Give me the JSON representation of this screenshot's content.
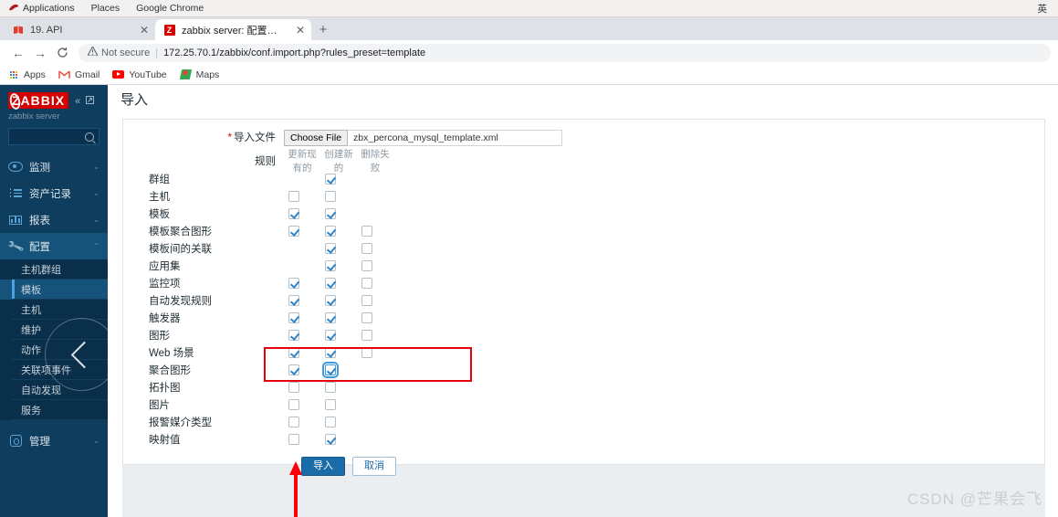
{
  "os_bar": {
    "apps_label": "Applications",
    "places_label": "Places",
    "app_label": "Google Chrome",
    "input_method": "英"
  },
  "browser": {
    "tabs": [
      {
        "title": "19. API",
        "favicon": "book-icon",
        "active": false
      },
      {
        "title": "zabbix server: 配置导入",
        "favicon": "zabbix-icon",
        "active": true
      }
    ],
    "new_tab_label": "+",
    "close_label": "✕",
    "back_label": "←",
    "forward_label": "→",
    "reload_label": "C",
    "security_label": "Not secure",
    "security_icon": "warning-triangle-icon",
    "url": "172.25.70.1/zabbix/conf.import.php?rules_preset=template",
    "bookmarks": [
      {
        "label": "Apps",
        "icon": "apps-grid-icon"
      },
      {
        "label": "Gmail",
        "icon": "gmail-icon"
      },
      {
        "label": "YouTube",
        "icon": "youtube-icon"
      },
      {
        "label": "Maps",
        "icon": "maps-icon"
      }
    ]
  },
  "sidebar": {
    "brand": "ZABBIX",
    "collapse_label": "«",
    "hide_label": "⇱",
    "server_name": "zabbix server",
    "search_placeholder": "",
    "nav": [
      {
        "label": "监测",
        "icon": "eye-icon",
        "caret": "⌄",
        "active": false
      },
      {
        "label": "资产记录",
        "icon": "list-icon",
        "caret": "⌄",
        "active": false
      },
      {
        "label": "报表",
        "icon": "bar-chart-icon",
        "caret": "⌄",
        "active": false
      },
      {
        "label": "配置",
        "icon": "wrench-icon",
        "caret": "⌃",
        "active": true
      }
    ],
    "subnav": [
      {
        "label": "主机群组",
        "current": false
      },
      {
        "label": "模板",
        "current": true
      },
      {
        "label": "主机",
        "current": false
      },
      {
        "label": "维护",
        "current": false
      },
      {
        "label": "动作",
        "current": false
      },
      {
        "label": "关联项事件",
        "current": false
      },
      {
        "label": "自动发现",
        "current": false
      },
      {
        "label": "服务",
        "current": false
      }
    ],
    "admin": {
      "label": "管理",
      "icon": "gear-icon",
      "caret": "⌄"
    }
  },
  "page": {
    "title": "导入",
    "file_row": {
      "label": "导入文件",
      "required_marker": "*",
      "choose_button": "Choose File",
      "file_name": "zbx_percona_mysql_template.xml"
    },
    "rules_label": "规则",
    "column_headers": [
      "更新现有的",
      "创建新的",
      "删除失败"
    ],
    "rules": [
      {
        "label": "群组",
        "update": null,
        "create": true,
        "delete": null
      },
      {
        "label": "主机",
        "update": false,
        "create": false,
        "delete": null
      },
      {
        "label": "模板",
        "update": true,
        "create": true,
        "delete": null
      },
      {
        "label": "模板聚合图形",
        "update": true,
        "create": true,
        "delete": false
      },
      {
        "label": "模板间的关联",
        "update": null,
        "create": true,
        "delete": false
      },
      {
        "label": "应用集",
        "update": null,
        "create": true,
        "delete": false
      },
      {
        "label": "监控项",
        "update": true,
        "create": true,
        "delete": false
      },
      {
        "label": "自动发现规则",
        "update": true,
        "create": true,
        "delete": false
      },
      {
        "label": "触发器",
        "update": true,
        "create": true,
        "delete": false
      },
      {
        "label": "图形",
        "update": true,
        "create": true,
        "delete": false
      },
      {
        "label": "Web 场景",
        "update": true,
        "create": true,
        "delete": false
      },
      {
        "label": "聚合图形",
        "update": true,
        "create": true,
        "delete": null,
        "create_focus": true
      },
      {
        "label": "拓扑图",
        "update": false,
        "create": false,
        "delete": null
      },
      {
        "label": "图片",
        "update": false,
        "create": false,
        "delete": null
      },
      {
        "label": "报警媒介类型",
        "update": false,
        "create": false,
        "delete": null
      },
      {
        "label": "映射值",
        "update": false,
        "create": true,
        "delete": null
      }
    ],
    "submit_button": "导入",
    "cancel_button": "取消"
  },
  "annotations": {
    "highlight_row": "聚合图形",
    "highlight_color": "#e8000d",
    "arrow_target": "导入"
  },
  "watermark": "CSDN @芒果会飞"
}
